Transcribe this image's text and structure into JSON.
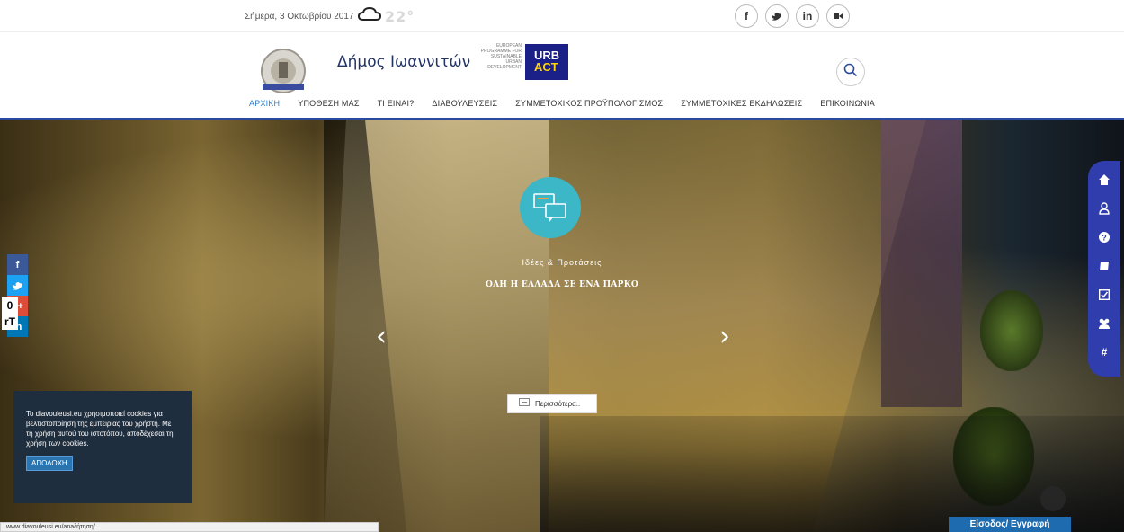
{
  "topbar": {
    "date": "Σήμερα, 3 Οκτωβρίου 2017",
    "temperature": "22°",
    "social": [
      {
        "icon": "facebook-icon",
        "glyph": "f"
      },
      {
        "icon": "twitter-icon",
        "glyph": "🐦"
      },
      {
        "icon": "linkedin-icon",
        "glyph": "in"
      },
      {
        "icon": "video-icon",
        "glyph": "■"
      }
    ]
  },
  "header": {
    "title": "Δήμος Ιωαννιτών",
    "urbact_tagline": "EUROPEAN PROGRAMME FOR SUSTAINABLE URBAN DEVELOPMENT",
    "urbact_line1": "URB",
    "urbact_line2": "ACT"
  },
  "nav": {
    "items": [
      "ΑΡΧΙΚΗ",
      "ΥΠΟΘΕΣΗ ΜΑΣ",
      "ΤΙ ΕΙΝΑΙ?",
      "ΔΙΑΒΟΥΛΕΥΣΕΙΣ",
      "ΣΥΜΜΕΤΟΧΙΚΟΣ ΠΡΟΫΠΟΛΟΓΙΣΜΟΣ",
      "ΣΥΜΜΕΤΟΧΙΚΕΣ ΕΚΔΗΛΩΣΕΙΣ",
      "ΕΠΙΚΟΙΝΩΝΙΑ"
    ],
    "active_index": 0
  },
  "slide": {
    "category": "Ιδέες & Προτάσεις",
    "title": "ΟΛΗ Η ΕΛΛΑΔΑ ΣΕ ΕΝΑ ΠΑΡΚΟ",
    "more_label": "Περισσότερα..",
    "prev_glyph": "‹",
    "next_glyph": "›"
  },
  "left_social": [
    {
      "glyph": "f",
      "color": "#3b5998"
    },
    {
      "glyph": "t",
      "color": "#1da1f2"
    },
    {
      "glyph": "g+",
      "color": "#dd4b39"
    },
    {
      "glyph": "in",
      "color": "#0077b5"
    }
  ],
  "side_text": {
    "line1": "0",
    "line2": "rT"
  },
  "right_bar": {
    "icons": [
      "home-icon",
      "user-icon",
      "question-icon",
      "book-icon",
      "checkbox-icon",
      "users-icon",
      "hashtag-icon"
    ],
    "color": "#2f3dad"
  },
  "cookie": {
    "text": "Το diavouleusi.eu χρησιμοποιεί cookies για βελτιστοποίηση της εμπειρίας του χρήστη. Με τη χρήση αυτού του ιστοτόπου, αποδέχεσαι τη χρήση των cookies.",
    "accept_label": "ΑΠΟΔΟΧΗ"
  },
  "status_bar": {
    "url": "www.diavouleusi.eu/anaζήτηση/"
  },
  "login_label": "Είσοδος/ Εγγραφή",
  "colors": {
    "accent": "#2a4aa0",
    "active_nav": "#2a7fd0",
    "cookie_bg": "#1f2e3e",
    "login_bg": "#1e6bb0",
    "idea_icon": "#3bb7c8"
  }
}
